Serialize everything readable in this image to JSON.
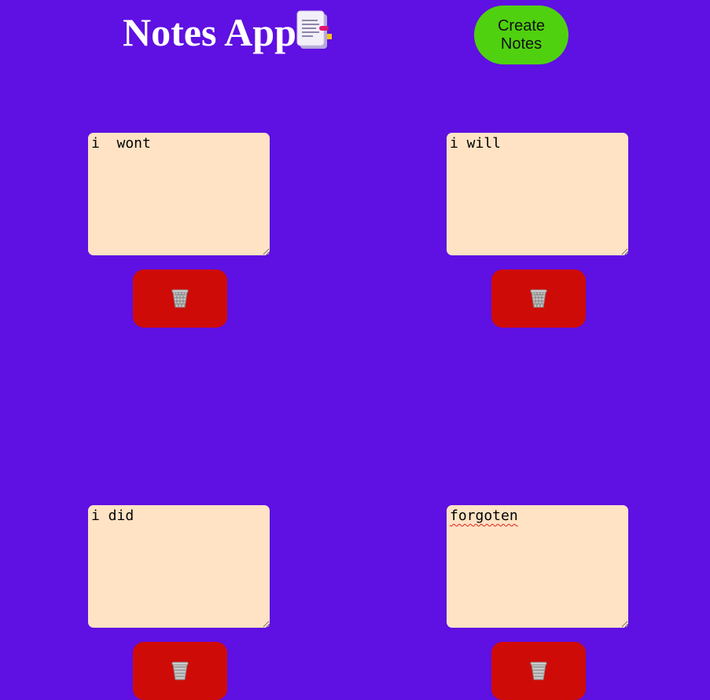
{
  "header": {
    "title": "Notes App",
    "title_icon": "notepad-icon",
    "create_button_label": "Create Notes"
  },
  "notes": [
    {
      "text": "i  wont",
      "delete_icon": "wastebasket-icon"
    },
    {
      "text": "i will",
      "delete_icon": "wastebasket-icon"
    },
    {
      "text": "i did",
      "delete_icon": "wastebasket-icon"
    },
    {
      "text": "forgoten",
      "delete_icon": "wastebasket-icon"
    }
  ],
  "colors": {
    "background": "#5f10e2",
    "create_button": "#50d10f",
    "note_background": "#ffe3c4",
    "delete_button": "#cf0b08",
    "title_text": "#ffffff"
  }
}
